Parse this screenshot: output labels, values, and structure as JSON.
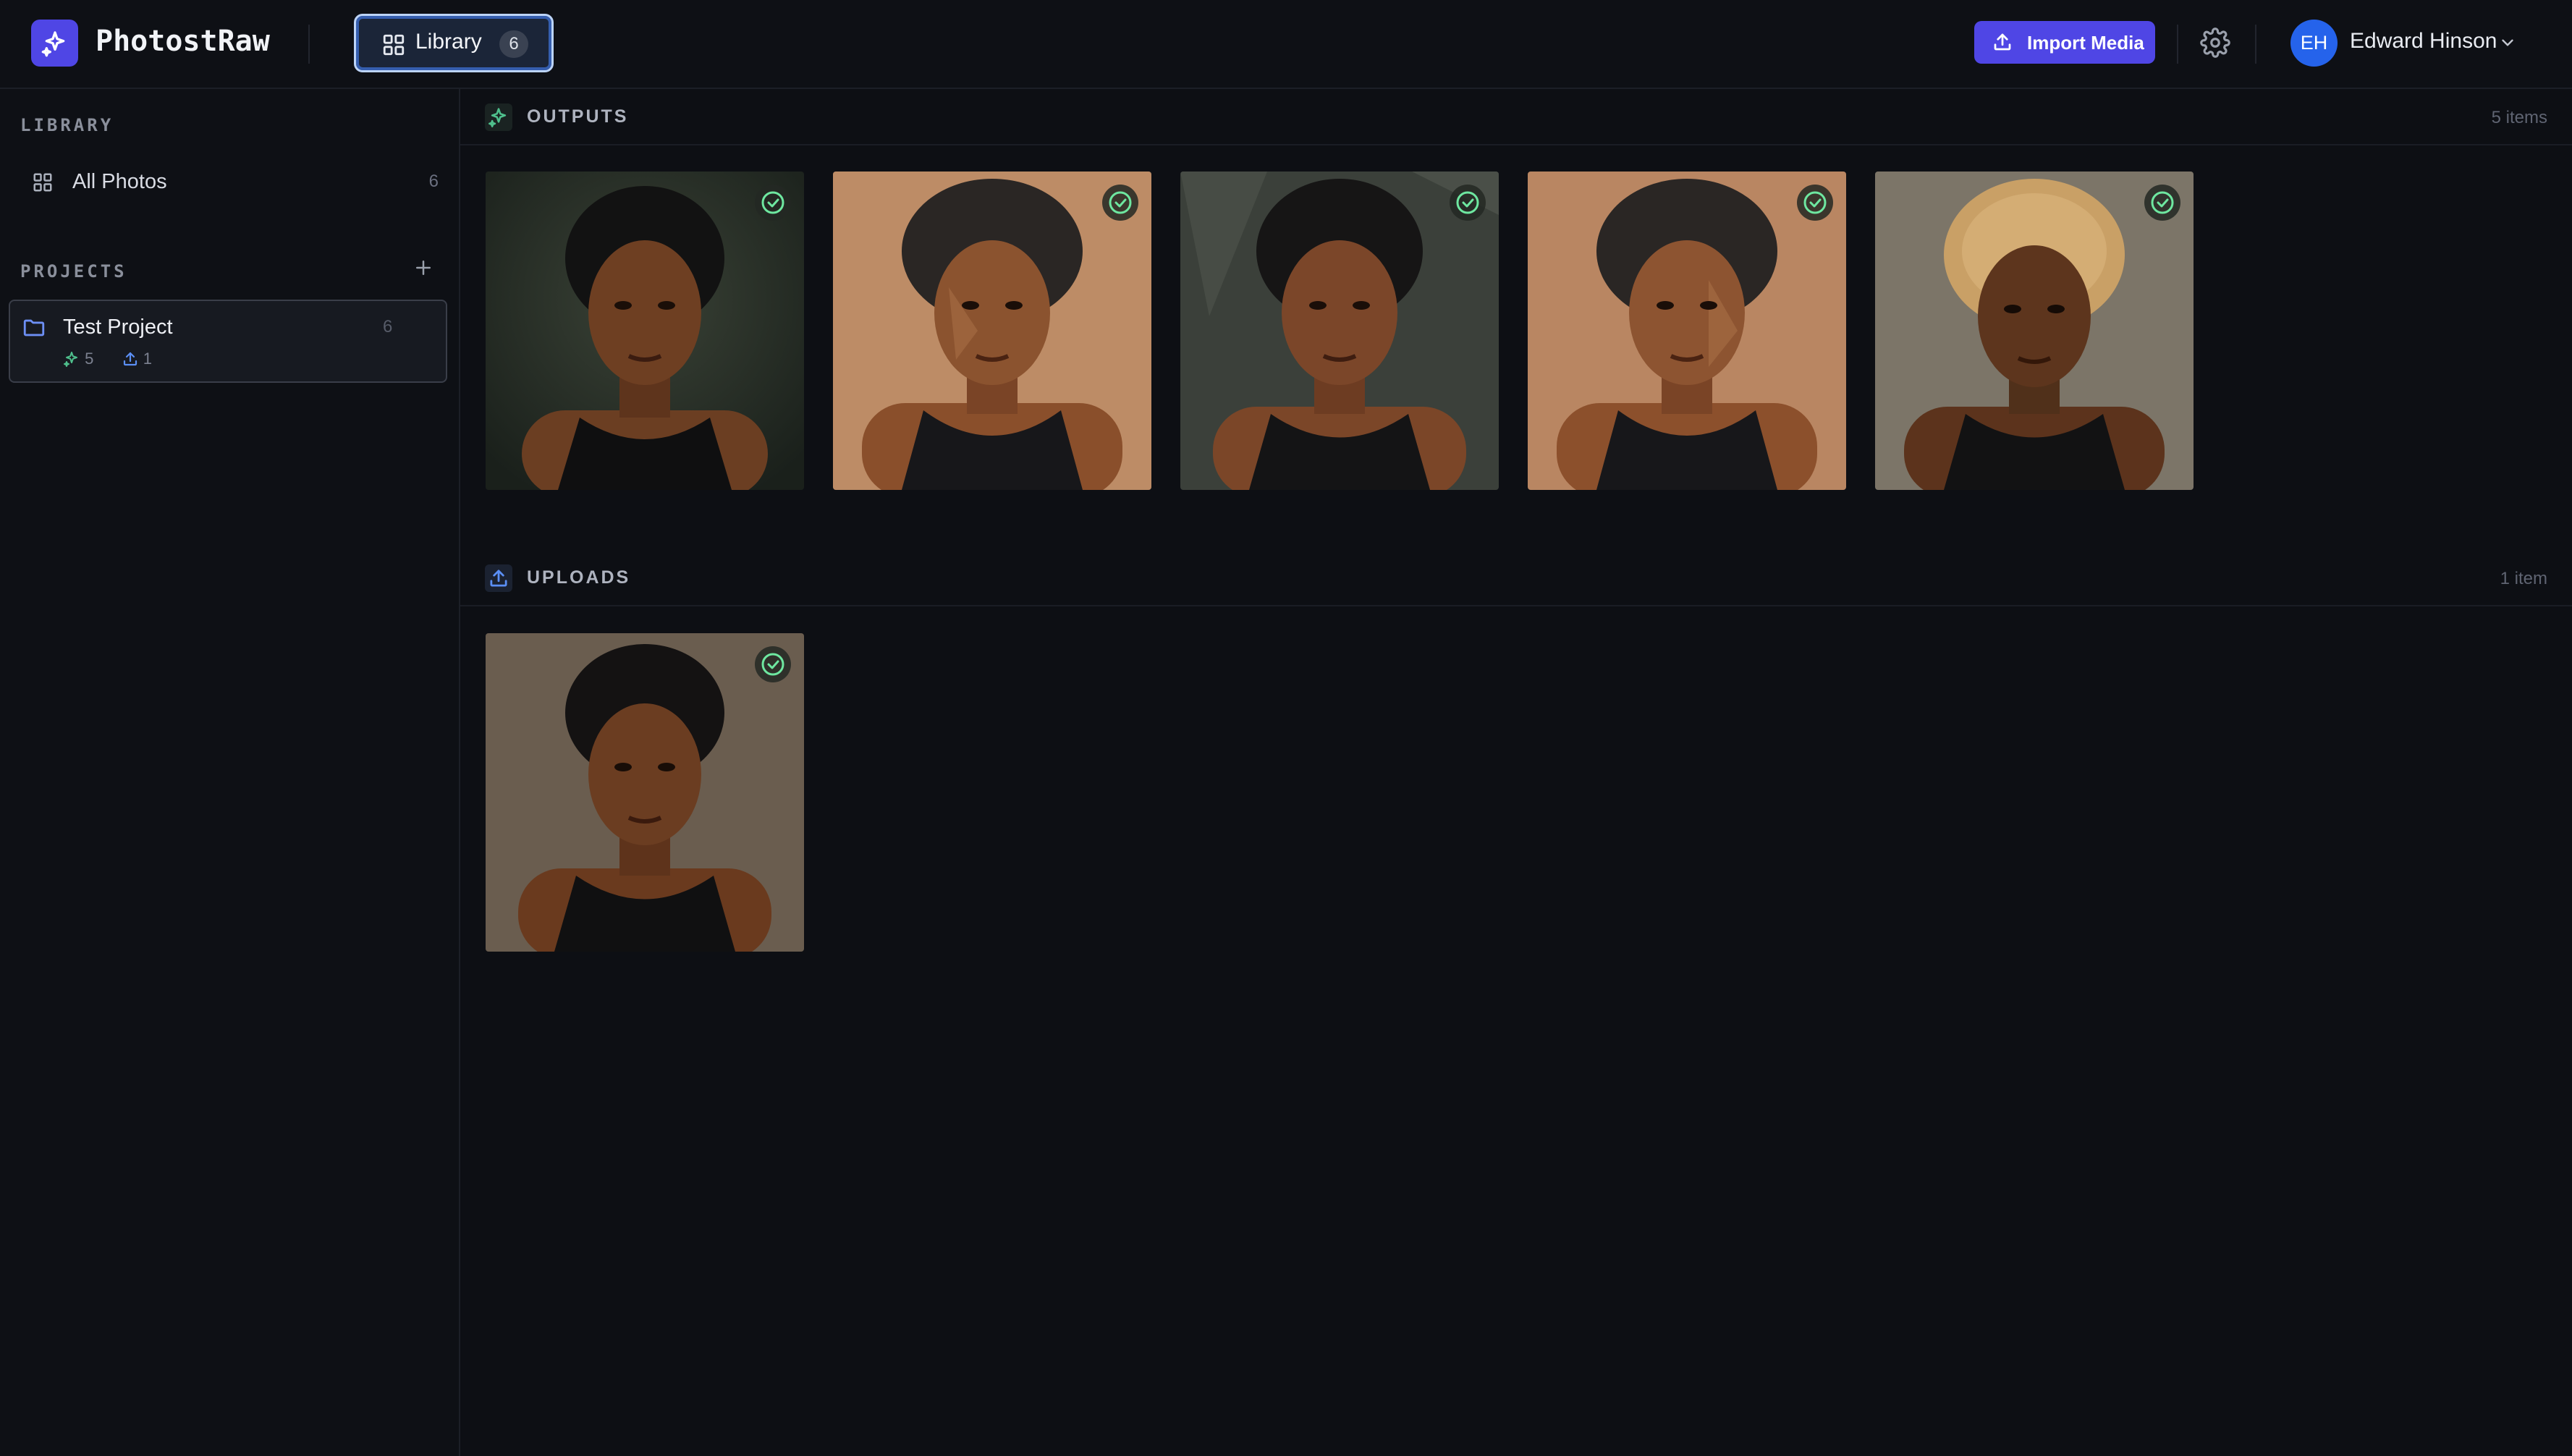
{
  "app": {
    "title": "PhotostRaw"
  },
  "header": {
    "tab": {
      "label": "Library",
      "count": "6"
    },
    "import_label": "Import Media",
    "user": {
      "initials": "EH",
      "name": "Edward Hinson"
    }
  },
  "sidebar": {
    "library_heading": "LIBRARY",
    "all_photos": {
      "label": "All Photos",
      "count": "6"
    },
    "projects_heading": "PROJECTS",
    "project": {
      "name": "Test Project",
      "count": "6",
      "outputs": "5",
      "uploads": "1"
    }
  },
  "main": {
    "outputs": {
      "title": "OUTPUTS",
      "count": "5 items"
    },
    "uploads": {
      "title": "UPLOADS",
      "count": "1 item"
    }
  },
  "colors": {
    "accent": "#4f46e5",
    "avatar": "#2563eb",
    "check": "#6ee7a0"
  }
}
